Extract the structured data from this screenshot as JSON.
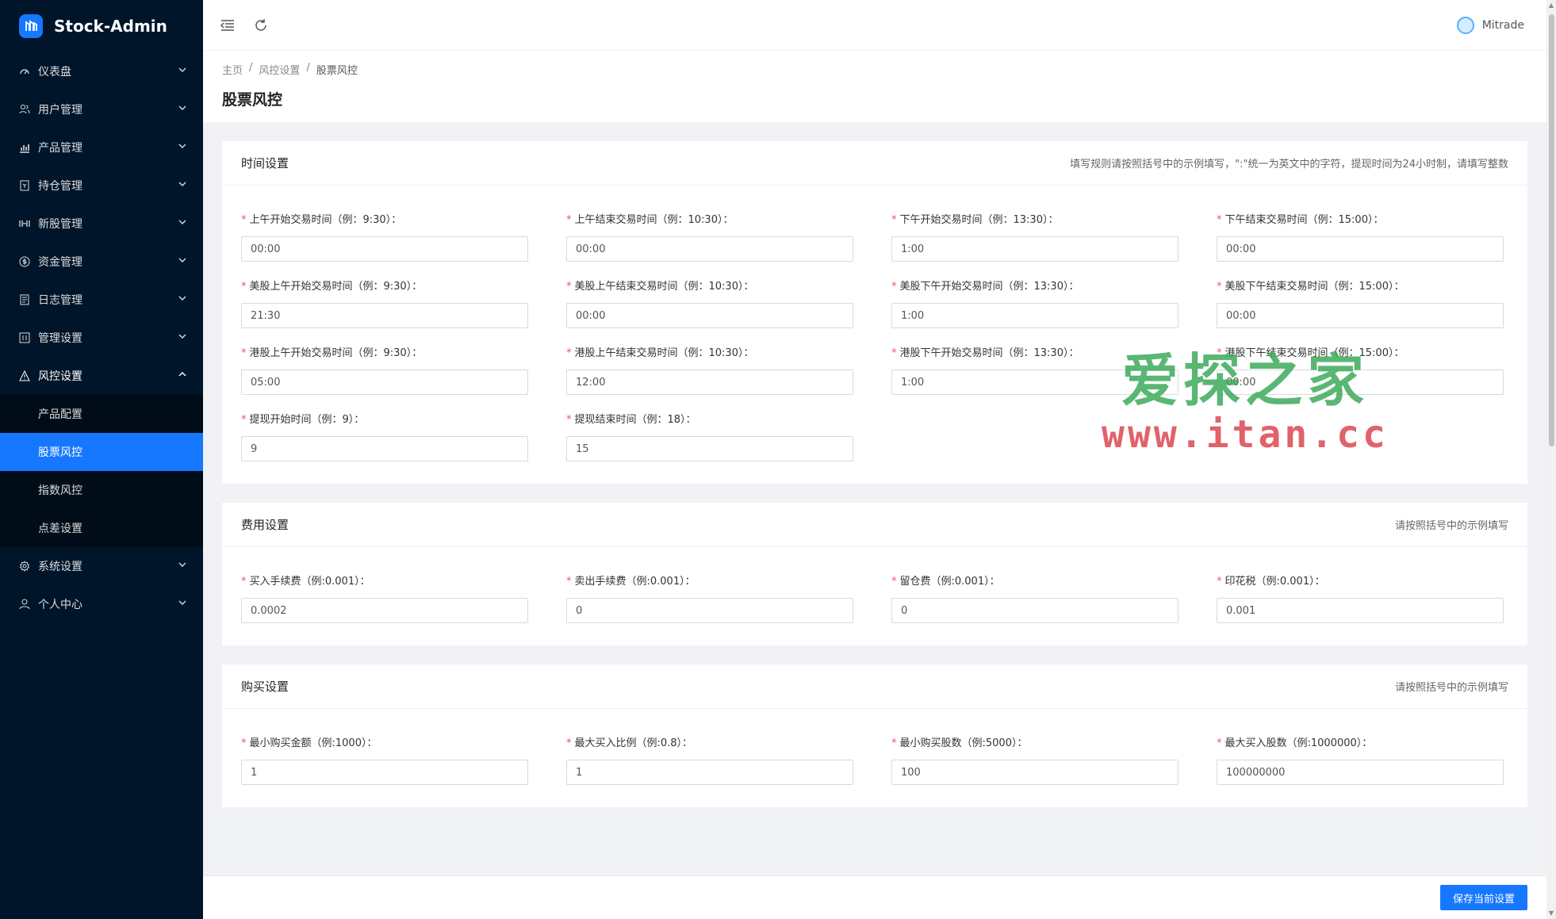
{
  "app": {
    "name": "Stock-Admin",
    "user": "Mitrade"
  },
  "sidebar": {
    "items": [
      {
        "label": "仪表盘",
        "icon": "dashboard-icon",
        "expanded": false
      },
      {
        "label": "用户管理",
        "icon": "users-icon",
        "expanded": false
      },
      {
        "label": "产品管理",
        "icon": "chart-icon",
        "expanded": false
      },
      {
        "label": "持仓管理",
        "icon": "position-icon",
        "expanded": false
      },
      {
        "label": "新股管理",
        "icon": "ipo-icon",
        "expanded": false
      },
      {
        "label": "资金管理",
        "icon": "dollar-icon",
        "expanded": false
      },
      {
        "label": "日志管理",
        "icon": "log-icon",
        "expanded": false
      },
      {
        "label": "管理设置",
        "icon": "manage-icon",
        "expanded": false
      },
      {
        "label": "风控设置",
        "icon": "warning-icon",
        "expanded": true,
        "children": [
          {
            "label": "产品配置",
            "active": false
          },
          {
            "label": "股票风控",
            "active": true
          },
          {
            "label": "指数风控",
            "active": false
          },
          {
            "label": "点差设置",
            "active": false
          }
        ]
      },
      {
        "label": "系统设置",
        "icon": "gear-icon",
        "expanded": false
      },
      {
        "label": "个人中心",
        "icon": "person-icon",
        "expanded": false
      }
    ]
  },
  "breadcrumb": [
    "主页",
    "风控设置",
    "股票风控"
  ],
  "page_title": "股票风控",
  "cards": [
    {
      "title": "时间设置",
      "extra": "填写规则请按照括号中的示例填写，\":\"统一为英文中的字符，提现时间为24小时制，请填写整数",
      "fields": [
        {
          "label": "上午开始交易时间（例：9:30）：",
          "value": "00:00"
        },
        {
          "label": "上午结束交易时间（例：10:30）：",
          "value": "00:00"
        },
        {
          "label": "下午开始交易时间（例：13:30）：",
          "value": "1:00"
        },
        {
          "label": "下午结束交易时间（例：15:00）：",
          "value": "00:00"
        },
        {
          "label": "美股上午开始交易时间（例：9:30）：",
          "value": "21:30"
        },
        {
          "label": "美股上午结束交易时间（例：10:30）：",
          "value": "00:00"
        },
        {
          "label": "美股下午开始交易时间（例：13:30）：",
          "value": "1:00"
        },
        {
          "label": "美股下午结束交易时间（例：15:00）：",
          "value": "00:00"
        },
        {
          "label": "港股上午开始交易时间（例：9:30）：",
          "value": "05:00"
        },
        {
          "label": "港股上午结束交易时间（例：10:30）：",
          "value": "12:00"
        },
        {
          "label": "港股下午开始交易时间（例：13:30）：",
          "value": "1:00"
        },
        {
          "label": "港股下午结束交易时间（例：15:00）：",
          "value": "00:00"
        },
        {
          "label": "提现开始时间（例：9）：",
          "value": "9"
        },
        {
          "label": "提现结束时间（例：18）：",
          "value": "15"
        }
      ]
    },
    {
      "title": "费用设置",
      "extra": "请按照括号中的示例填写",
      "fields": [
        {
          "label": "买入手续费（例:0.001）：",
          "value": "0.0002"
        },
        {
          "label": "卖出手续费（例:0.001）：",
          "value": "0"
        },
        {
          "label": "留仓费（例:0.001）：",
          "value": "0"
        },
        {
          "label": "印花税（例:0.001）：",
          "value": "0.001"
        }
      ]
    },
    {
      "title": "购买设置",
      "extra": "请按照括号中的示例填写",
      "fields": [
        {
          "label": "最小购买金额（例:1000）：",
          "value": "1"
        },
        {
          "label": "最大买入比例（例:0.8）：",
          "value": "1"
        },
        {
          "label": "最小购买股数（例:5000）：",
          "value": "100"
        },
        {
          "label": "最大买入股数（例:1000000）：",
          "value": "100000000"
        }
      ]
    }
  ],
  "footer": {
    "save_label": "保存当前设置"
  },
  "watermark": {
    "top": "爱探之家",
    "bottom": "www.itan.cc"
  },
  "colors": {
    "sidebar_bg": "#001529",
    "accent": "#1677ff",
    "required": "#ff4d4f"
  }
}
